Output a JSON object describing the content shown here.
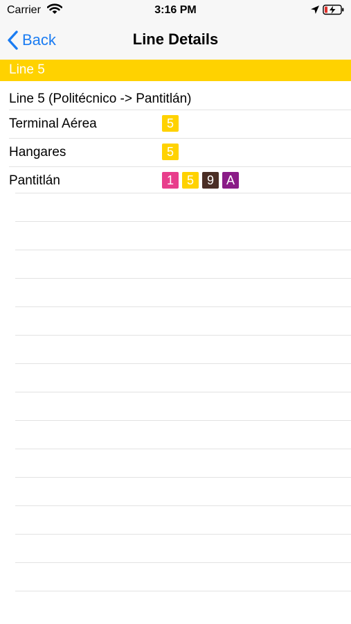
{
  "status_bar": {
    "carrier": "Carrier",
    "time": "3:16 PM"
  },
  "nav": {
    "back_label": "Back",
    "title": "Line Details"
  },
  "section": {
    "label": "Line 5",
    "color": "#ffd200"
  },
  "route": {
    "label": "Line 5 (Politécnico -> Pantitlán)"
  },
  "stations": [
    {
      "name": "Terminal Aérea",
      "lines": [
        {
          "label": "5",
          "color": "#ffd200"
        }
      ]
    },
    {
      "name": "Hangares",
      "lines": [
        {
          "label": "5",
          "color": "#ffd200"
        }
      ]
    },
    {
      "name": "Pantitlán",
      "lines": [
        {
          "label": "1",
          "color": "#e83e8c"
        },
        {
          "label": "5",
          "color": "#ffd200"
        },
        {
          "label": "9",
          "color": "#4a2e25"
        },
        {
          "label": "A",
          "color": "#8a1c87"
        }
      ]
    }
  ]
}
